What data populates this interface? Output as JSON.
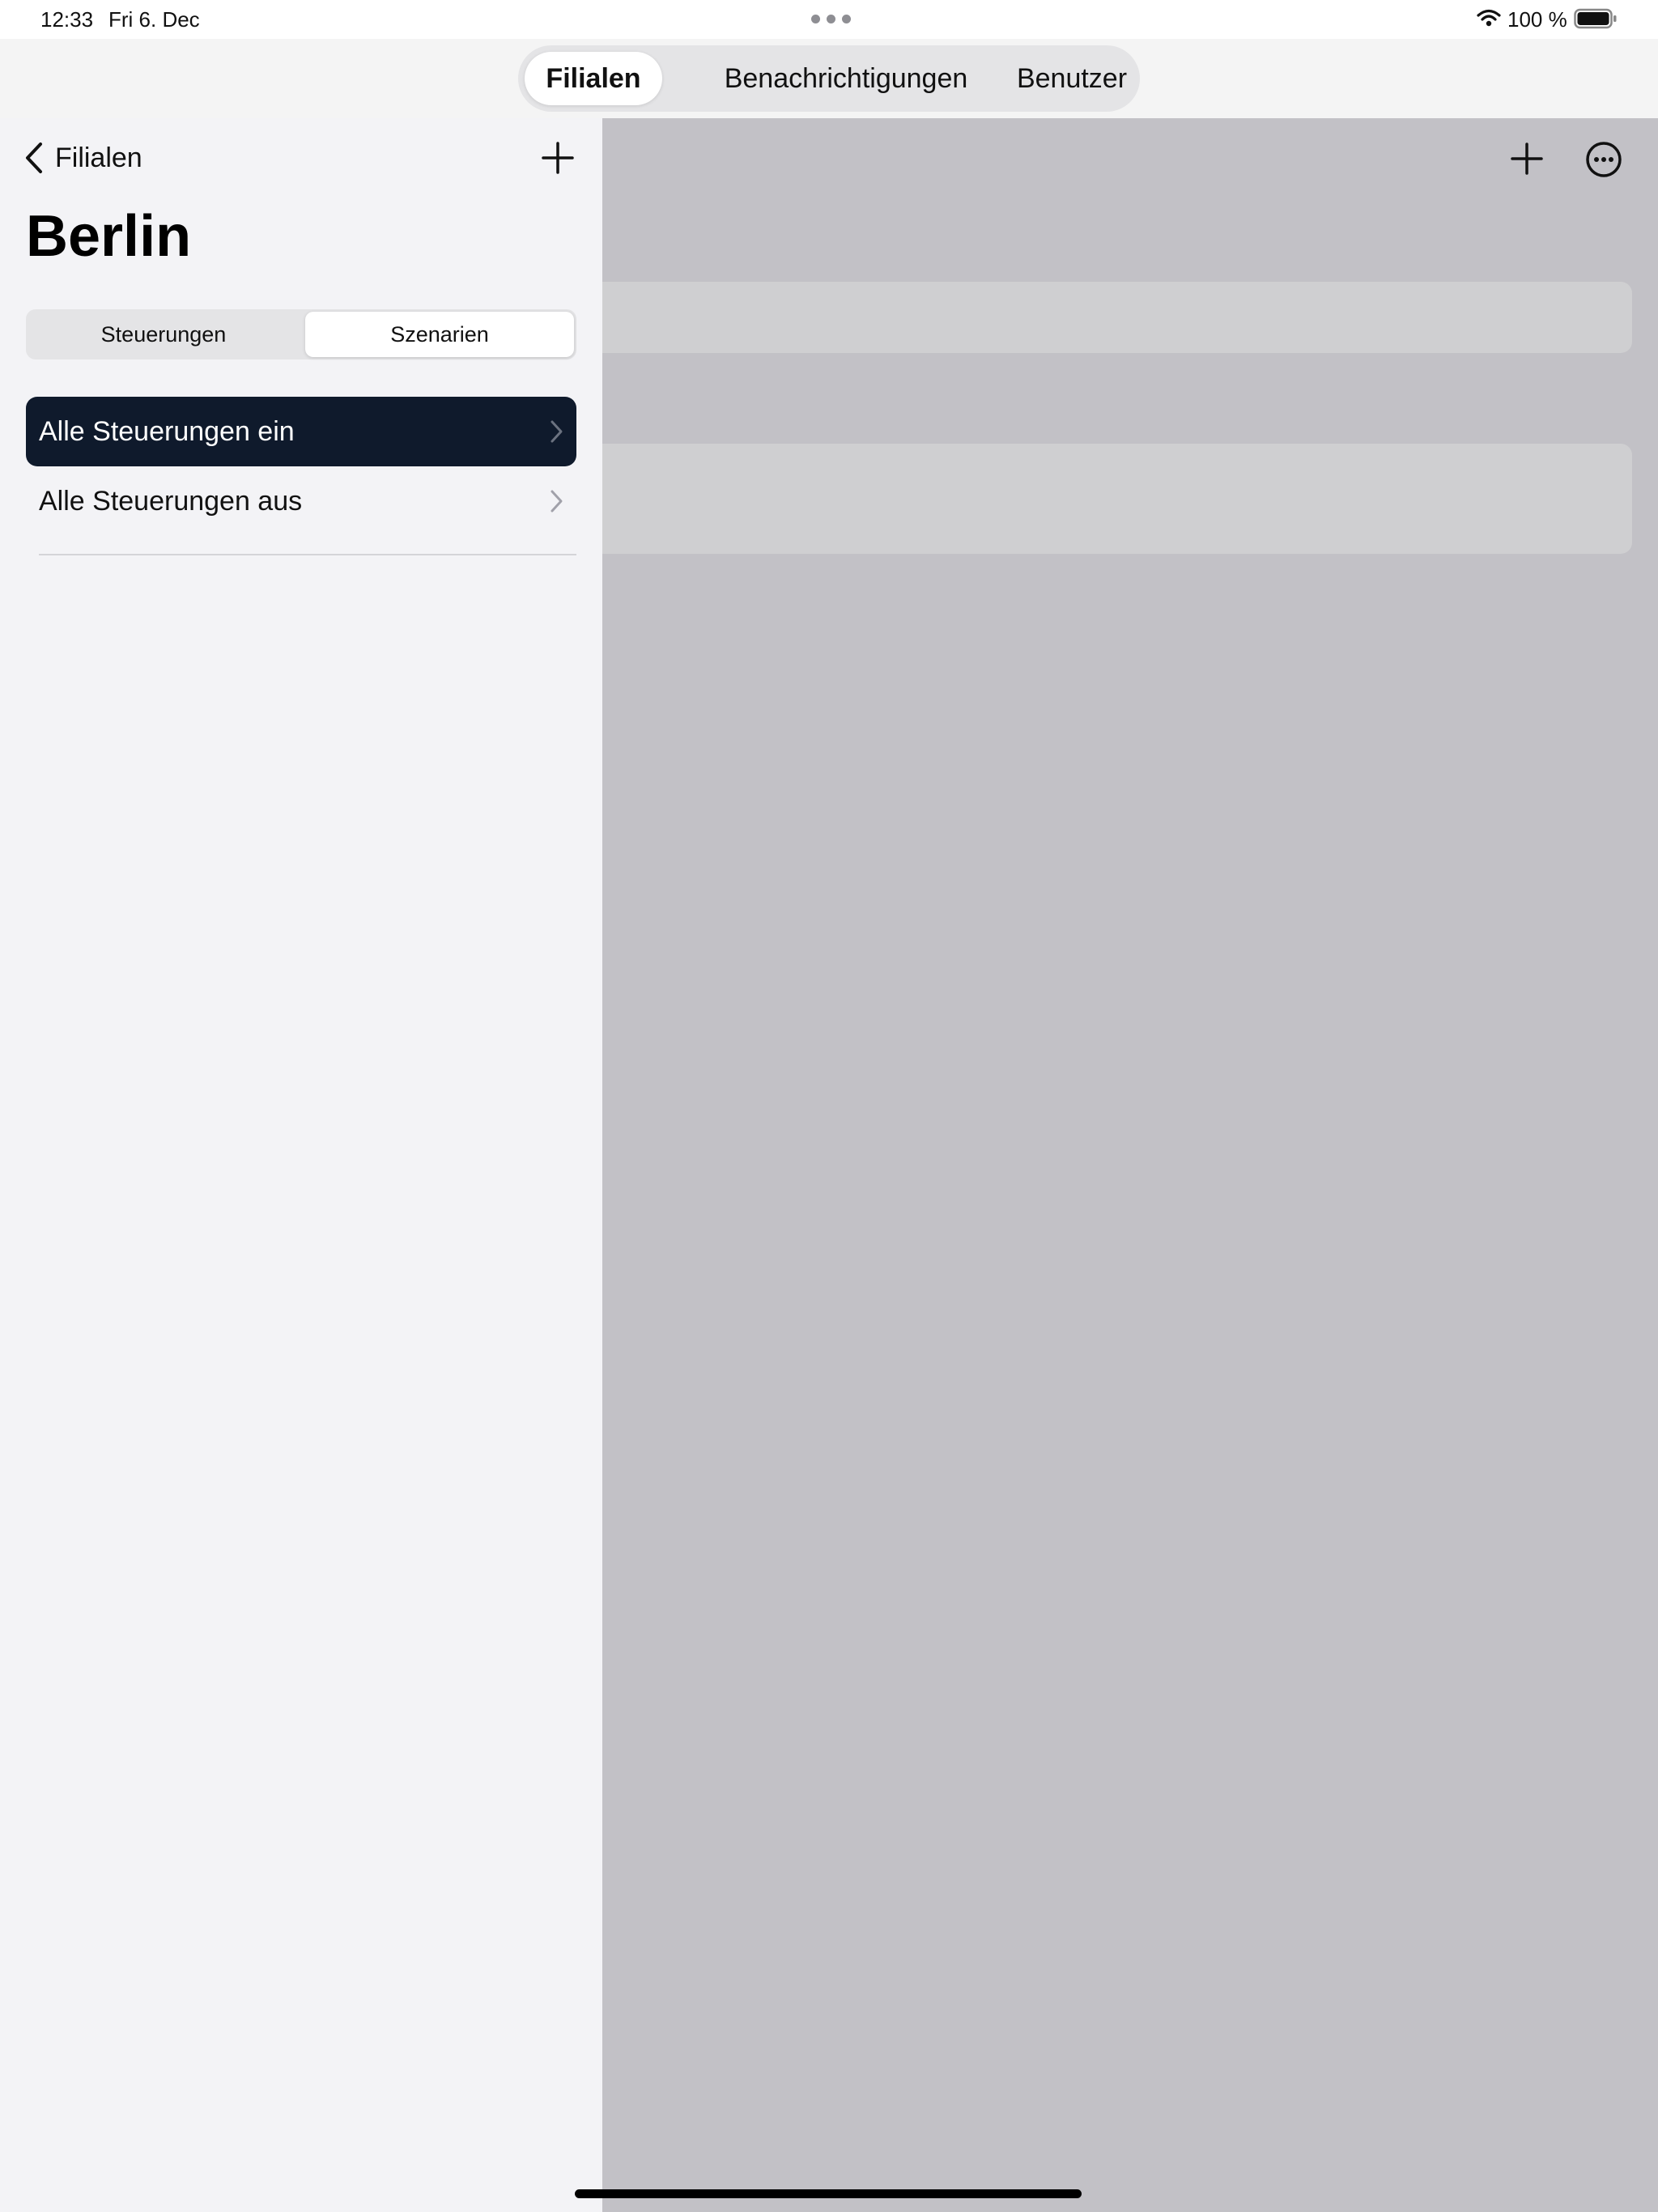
{
  "status_bar": {
    "time": "12:33",
    "date": "Fri 6. Dec",
    "battery": "100 %"
  },
  "top_tabs": {
    "items": [
      {
        "label": "Filialen",
        "selected": true
      },
      {
        "label": "Benachrichtigungen",
        "selected": false
      },
      {
        "label": "Benutzer",
        "selected": false
      }
    ]
  },
  "sidebar": {
    "back_label": "Filialen",
    "title": "Berlin",
    "segments": [
      {
        "label": "Steuerungen",
        "selected": false
      },
      {
        "label": "Szenarien",
        "selected": true
      }
    ],
    "rows": [
      {
        "label": "Alle Steuerungen ein",
        "selected": true
      },
      {
        "label": "Alle Steuerungen aus",
        "selected": false
      }
    ]
  },
  "icons": {
    "back": "chevron-left-icon",
    "add": "plus-icon",
    "more": "ellipsis-circle-icon",
    "row": "chevron-right-icon",
    "wifi": "wifi-icon",
    "battery": "battery-icon"
  },
  "colors": {
    "selected_row_bg": "#0f1a2c",
    "sidebar_bg": "#f3f3f6",
    "detail_dim_bg": "#c2c1c6"
  }
}
